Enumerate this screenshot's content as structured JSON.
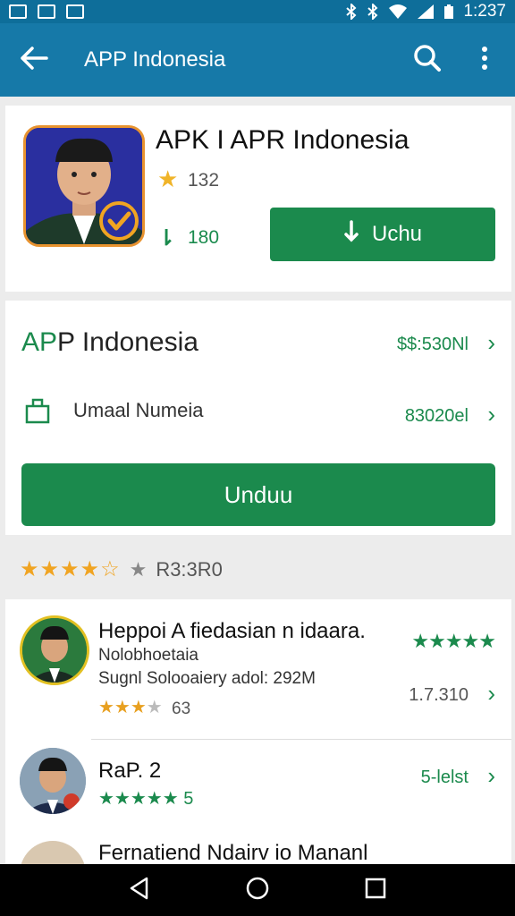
{
  "status_bar": {
    "time": "1:237"
  },
  "app_bar": {
    "title": "APP Indonesia"
  },
  "app_card": {
    "name": "APK I APR Indonesia",
    "rating": "132",
    "downloads": "180",
    "install_label": "Uchu"
  },
  "info_card": {
    "title_prefix": "AP",
    "title_rest": "P Indonesia",
    "price_primary": "$$:530Nl",
    "subtitle": "Umaal Numeia",
    "price_secondary": "83020el",
    "download_label": "Unduu"
  },
  "rating_summary": {
    "value": "R3:3R0",
    "stars_filled": 4,
    "stars_total": 5
  },
  "reviews": [
    {
      "name": "Heppoi A fiedasian n idaara.",
      "line1": "Nolobhoetaia",
      "line2": "Sugnl Solooaiery adol: 292M",
      "stars_filled": 3,
      "count": "63",
      "value": "1.7.310"
    },
    {
      "name": "RaP. 2",
      "stars_count": "5",
      "tag": "5-lelst"
    },
    {
      "name": "Fernatiend Ndairv io Mananl"
    }
  ],
  "colors": {
    "status_bar": "#0e6e9a",
    "app_bar": "#1679a8",
    "accent_green": "#1b8a4d",
    "star_orange": "#f0a422"
  },
  "icons": {
    "back": "arrow-left-icon",
    "search": "search-icon",
    "more": "more-vertical-icon",
    "nav_back": "triangle-back-icon",
    "nav_home": "circle-home-icon",
    "nav_recents": "square-recents-icon"
  }
}
